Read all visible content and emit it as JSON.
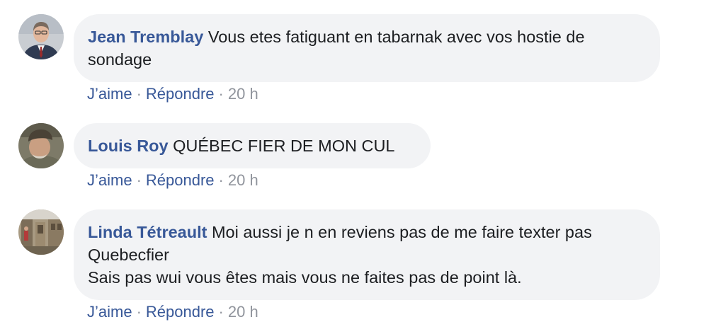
{
  "comments": [
    {
      "author": "Jean Tremblay",
      "text": "Vous etes fatiguant en tabarnak avec vos hostie de sondage",
      "like_label": "J’aime",
      "reply_label": "Répondre",
      "time": "20 h",
      "avatar_icon": "man-in-suit-avatar"
    },
    {
      "author": "Louis Roy",
      "text": "QUÉBEC FIER DE MON CUL",
      "like_label": "J’aime",
      "reply_label": "Répondre",
      "time": "20 h",
      "avatar_icon": "older-man-with-cap-avatar"
    },
    {
      "author": "Linda Tétreault",
      "text": "Moi aussi je n en reviens pas de me faire texter pas Quebecfier\nSais pas wui vous êtes mais vous ne faites pas de point là.",
      "like_label": "J’aime",
      "reply_label": "Répondre",
      "time": "20 h",
      "avatar_icon": "building-photo-avatar"
    }
  ],
  "separator": "·",
  "colors": {
    "author": "#385898",
    "bubble": "#f2f3f5",
    "meta": "#90949c",
    "text": "#1c1e21"
  }
}
